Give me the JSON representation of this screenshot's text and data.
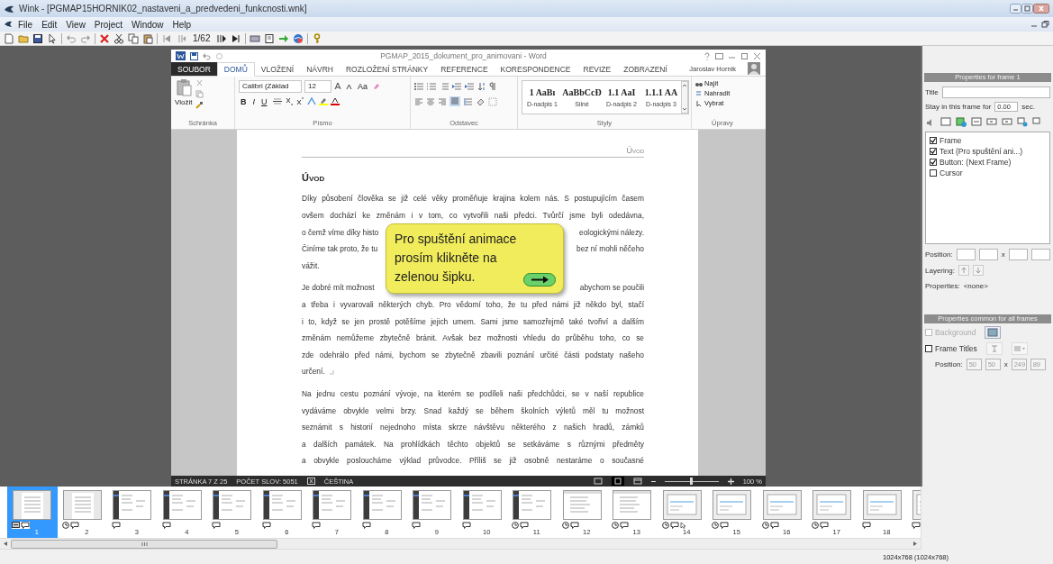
{
  "window": {
    "title": "Wink - [PGMAP15HORNIK02_nastaveni_a_predvedeni_funkcnosti.wnk]"
  },
  "menu": [
    "File",
    "Edit",
    "View",
    "Project",
    "Window",
    "Help"
  ],
  "toolbar": {
    "frame_counter": "1/62"
  },
  "word": {
    "title": "PGMAP_2015_dokument_pro_animovani - Word",
    "user": "Jaroslav Hornik",
    "tabs": [
      {
        "label": "SOUBOR",
        "kind": "file",
        "selected": false
      },
      {
        "label": "DOMŮ",
        "kind": "tab",
        "selected": true
      },
      {
        "label": "VLOŽENÍ",
        "kind": "tab",
        "selected": false
      },
      {
        "label": "NÁVRH",
        "kind": "tab",
        "selected": false
      },
      {
        "label": "ROZLOŽENÍ STRÁNKY",
        "kind": "tab",
        "selected": false
      },
      {
        "label": "REFERENCE",
        "kind": "tab",
        "selected": false
      },
      {
        "label": "KORESPONDENCE",
        "kind": "tab",
        "selected": false
      },
      {
        "label": "REVIZE",
        "kind": "tab",
        "selected": false
      },
      {
        "label": "ZOBRAZENÍ",
        "kind": "tab",
        "selected": false
      }
    ],
    "ribbon": {
      "paste": "Vložit",
      "font": "Calibri (Základ",
      "size": "12",
      "case": "Aa",
      "bold": "B",
      "italic": "I",
      "underline": "U",
      "styles": [
        {
          "sample": "1 AaBı",
          "label": "D-nadpis 1"
        },
        {
          "sample": "AaBbCcĐ",
          "label": "Silné"
        },
        {
          "sample": "1.1 AaI",
          "label": "D-nadpis 2"
        },
        {
          "sample": "1.1.1 AA",
          "label": "D-nadpis 3"
        }
      ],
      "editing": [
        "Najít",
        "Nahradit",
        "Vybrat"
      ],
      "groups": [
        "Schránka",
        "Písmo",
        "Odstavec",
        "Styly",
        "Úpravy"
      ]
    },
    "document": {
      "header": "Úvod",
      "heading": "Úvod",
      "paragraphs": [
        {
          "lines": [
            {
              "text": "Díky působení člověka se již celé věky proměňuje krajina kolem nás. S postupujícím časem"
            },
            {
              "text": "ovšem dochází ke změnám i v tom, co vytvořili naši předci. Tvůrčí jsme byli odedávna,"
            },
            {
              "left": "o čemž víme díky histo",
              "right": "eologickými nálezy."
            },
            {
              "left": "Činíme tak proto, že tu",
              "right": "bez ní mohli něčeho"
            },
            {
              "text": "vážit."
            }
          ]
        },
        {
          "lines": [
            {
              "left": "Je dobré mít možnost",
              "right": "abychom se poučili"
            },
            {
              "text": "a třeba i vyvarovali některých chyb. Pro vědomí toho, že tu před námi již někdo byl, stačí"
            },
            {
              "text": "i to, když se jen prostě potěšíme jejich umem. Sami jsme samozřejmě také tvořiví a dalším"
            },
            {
              "text": "změnám nemůžeme zbytečně bránit. Avšak bez možnosti vhledu do průběhu toho, co se"
            },
            {
              "text": "zde odehrálo před námi, bychom se zbytečně zbavili poznání určité části podstaty našeho"
            },
            {
              "text": "určení."
            }
          ]
        },
        {
          "lines": [
            {
              "text": "Na jednu cestu poznání vývoje, na kterém se podíleli naši předchůdci, se v naší republice"
            },
            {
              "text": "vydáváme obvykle velmi brzy. Snad každý se během školních výletů měl tu možnost"
            },
            {
              "text": "seznámit s historií nejednoho místa skrze návštěvu některého z našich hradů, zámků"
            },
            {
              "text": "a dalších památek. Na prohlídkách těchto objektů se setkáváme s různými předměty"
            },
            {
              "text": "a obvykle posloucháme výklad průvodce. Příliš se již osobně nestaráme o současné"
            }
          ]
        }
      ]
    },
    "callout": {
      "text": "Pro spuštění animace\nprosím klikněte na\nzelenou šipku."
    },
    "status": {
      "page": "STRÁNKA 7 Z 25",
      "words": "POČET SLOV: 5051",
      "language": "ČEŠTINA",
      "zoom": "100 %",
      "level": 0.5
    }
  },
  "frame_properties": {
    "header": "Properties for frame 1",
    "title_label": "Title",
    "stay_label": "Stay in this frame for",
    "stay_value": "0.00",
    "stay_unit": "sec.",
    "objects": [
      {
        "label": "Frame",
        "checked": true
      },
      {
        "label": "Text (Pro spuštění ani...)",
        "checked": true
      },
      {
        "label": "Button: (Next Frame)",
        "checked": true
      },
      {
        "label": "Cursor",
        "checked": false
      }
    ],
    "position_label": "Position:",
    "position_separator": "x",
    "layering_label": "Layering:",
    "properties_label": "Properties:",
    "properties_value": "<none>"
  },
  "common_properties": {
    "header": "Properties common for all frames",
    "options": [
      {
        "label": "Background",
        "checked": false,
        "disabled": true,
        "kind": "image"
      },
      {
        "label": "Frame Titles",
        "checked": false,
        "disabled": false,
        "kind": "text"
      }
    ],
    "position_label": "Position:",
    "position_values": [
      "50",
      "50",
      "249",
      "89"
    ],
    "position_separator": "x",
    "disabled": true
  },
  "filmstrip": {
    "frames": [
      {
        "number": "1",
        "selected": true,
        "kind": "document",
        "badges": [
          {
            "kind": "button"
          },
          {
            "kind": "comment"
          }
        ]
      },
      {
        "number": "2",
        "selected": false,
        "kind": "document",
        "badges": [
          {
            "kind": "timer"
          },
          {
            "kind": "comment"
          }
        ]
      },
      {
        "number": "3",
        "selected": false,
        "kind": "sidebar",
        "badges": [
          {
            "kind": "comment"
          }
        ]
      },
      {
        "number": "4",
        "selected": false,
        "kind": "sidebar",
        "badges": [
          {
            "kind": "comment"
          }
        ]
      },
      {
        "number": "5",
        "selected": false,
        "kind": "sidebar",
        "badges": [
          {
            "kind": "comment"
          }
        ]
      },
      {
        "number": "6",
        "selected": false,
        "kind": "sidebar",
        "badges": [
          {
            "kind": "comment"
          }
        ]
      },
      {
        "number": "7",
        "selected": false,
        "kind": "sidebar",
        "badges": [
          {
            "kind": "comment"
          }
        ]
      },
      {
        "number": "8",
        "selected": false,
        "kind": "sidebar",
        "badges": [
          {
            "kind": "comment"
          }
        ]
      },
      {
        "number": "9",
        "selected": false,
        "kind": "sidebar",
        "badges": [
          {
            "kind": "comment"
          }
        ]
      },
      {
        "number": "10",
        "selected": false,
        "kind": "sidebar",
        "badges": [
          {
            "kind": "comment"
          }
        ]
      },
      {
        "number": "11",
        "selected": false,
        "kind": "sidebar",
        "badges": [
          {
            "kind": "timer"
          },
          {
            "kind": "comment"
          }
        ]
      },
      {
        "number": "12",
        "selected": false,
        "kind": "list",
        "badges": [
          {
            "kind": "timer"
          },
          {
            "kind": "comment"
          }
        ]
      },
      {
        "number": "13",
        "selected": false,
        "kind": "list",
        "badges": [
          {
            "kind": "timer"
          },
          {
            "kind": "comment"
          }
        ]
      },
      {
        "number": "14",
        "selected": false,
        "kind": "dialog",
        "badges": [
          {
            "kind": "timer"
          },
          {
            "kind": "comment"
          },
          {
            "kind": "cursor"
          }
        ]
      },
      {
        "number": "15",
        "selected": false,
        "kind": "dialog",
        "badges": [
          {
            "kind": "timer"
          },
          {
            "kind": "comment"
          }
        ]
      },
      {
        "number": "16",
        "selected": false,
        "kind": "dialog",
        "badges": [
          {
            "kind": "timer"
          },
          {
            "kind": "comment"
          }
        ]
      },
      {
        "number": "17",
        "selected": false,
        "kind": "dialog",
        "badges": [
          {
            "kind": "timer"
          },
          {
            "kind": "comment"
          }
        ]
      },
      {
        "number": "18",
        "selected": false,
        "kind": "dialog",
        "badges": [
          {
            "kind": "comment"
          }
        ]
      },
      {
        "selected": false,
        "kind": "dialog",
        "badges": [
          {
            "kind": "comment"
          }
        ]
      }
    ]
  },
  "status_bar": {
    "resolution": "1024x768 (1024x768)"
  }
}
